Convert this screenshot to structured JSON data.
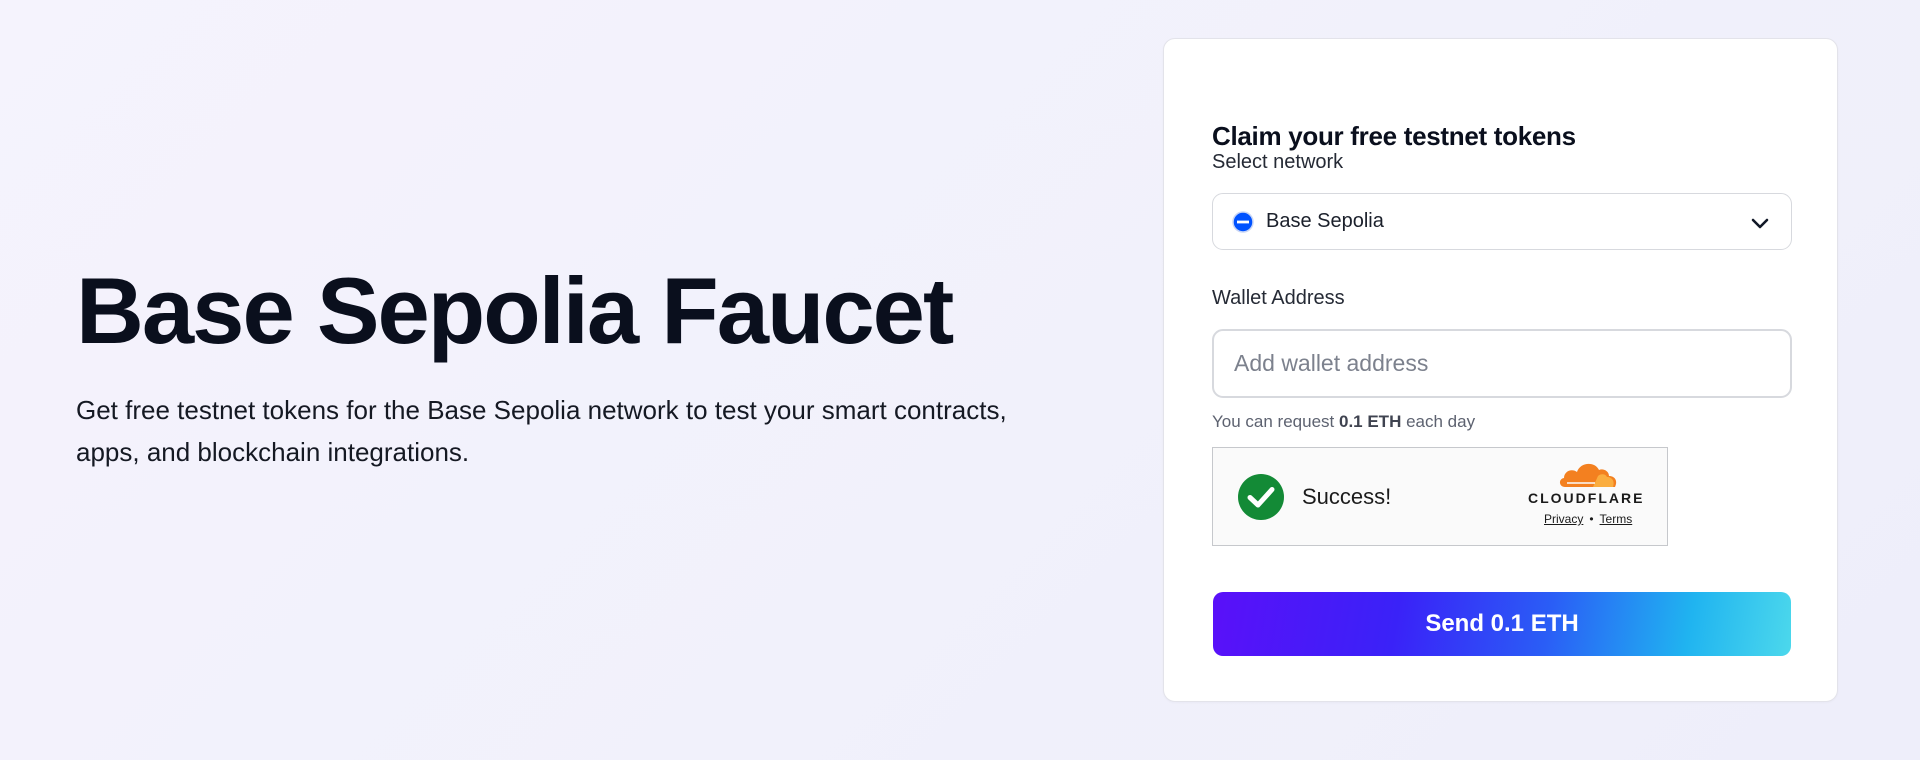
{
  "hero": {
    "title": "Base Sepolia Faucet",
    "description": "Get free testnet tokens for the Base Sepolia network to test your smart contracts, apps, and blockchain integrations."
  },
  "claim_card": {
    "title": "Claim your free testnet tokens",
    "network_label": "Select network",
    "network_selected": "Base Sepolia",
    "network_icon": "base-logo-icon",
    "dropdown_icon": "chevron-down-icon",
    "wallet_label": "Wallet Address",
    "wallet_value": "",
    "wallet_placeholder": "Add wallet address",
    "limit_prefix": "You can request",
    "limit_amount": "0.1 ETH",
    "limit_suffix": "each day",
    "send_label": "Send 0.1 ETH"
  },
  "captcha": {
    "status": "Success!",
    "status_icon": "check-circle-icon",
    "provider": "CLOUDFLARE",
    "privacy_link": "Privacy",
    "separator": "•",
    "terms_link": "Terms"
  },
  "colors": {
    "primary_text": "#0a0f1d",
    "base_blue": "#0052ff",
    "success_green": "#138a36",
    "cloudflare_orange": "#f38020",
    "button_gradient_start": "#5a10f9",
    "button_gradient_end": "#4cd8ec"
  }
}
